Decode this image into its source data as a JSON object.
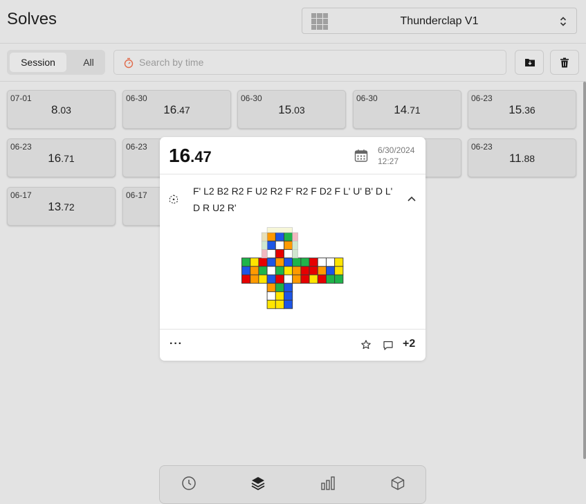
{
  "header": {
    "title": "Solves",
    "cube_name": "Thunderclap V1"
  },
  "toolbar": {
    "tab_session": "Session",
    "tab_all": "All",
    "search_placeholder": "Search by time"
  },
  "solves": [
    {
      "date": "07-01",
      "whole": "8",
      "dec": ".03"
    },
    {
      "date": "06-30",
      "whole": "16",
      "dec": ".47"
    },
    {
      "date": "06-30",
      "whole": "15",
      "dec": ".03"
    },
    {
      "date": "06-30",
      "whole": "14",
      "dec": ".71"
    },
    {
      "date": "06-23",
      "whole": "15",
      "dec": ".36"
    },
    {
      "date": "06-23",
      "whole": "16",
      "dec": ".71"
    },
    {
      "date": "06-23",
      "whole": "",
      "dec": ""
    },
    {
      "date": "",
      "whole": "",
      "dec": ""
    },
    {
      "date": "",
      "whole": "",
      "dec": ""
    },
    {
      "date": "06-23",
      "whole": "11",
      "dec": ".88"
    },
    {
      "date": "06-17",
      "whole": "13",
      "dec": ".72"
    },
    {
      "date": "06-17",
      "whole": "",
      "dec": ""
    }
  ],
  "detail": {
    "whole": "16",
    "dec": ".47",
    "date": "6/30/2024",
    "time": "12:27",
    "scramble": "F' L2 B2 R2 F U2 R2 F' R2 F D2 F L' U' B' D L' D R U2 R'",
    "more_label": "···",
    "penalty_label": "+2"
  },
  "cube_net": {
    "U": [
      [
        "O",
        "B",
        "G"
      ],
      [
        "B",
        "W",
        "O"
      ],
      [
        "W",
        "R",
        "W"
      ]
    ],
    "L": [
      [
        "G",
        "Y",
        "R"
      ],
      [
        "B",
        "O",
        "G"
      ],
      [
        "R",
        "O",
        "Y"
      ]
    ],
    "F": [
      [
        "B",
        "O",
        "B"
      ],
      [
        "W",
        "G",
        "Y"
      ],
      [
        "B",
        "R",
        "W"
      ]
    ],
    "R": [
      [
        "G",
        "G",
        "R"
      ],
      [
        "O",
        "R",
        "R"
      ],
      [
        "O",
        "R",
        "Y"
      ]
    ],
    "B": [
      [
        "W",
        "W",
        "Y"
      ],
      [
        "O",
        "B",
        "Y"
      ],
      [
        "R",
        "G",
        "G"
      ]
    ],
    "D": [
      [
        "O",
        "G",
        "B"
      ],
      [
        "W",
        "Y",
        "B"
      ],
      [
        "Y",
        "Y",
        "B"
      ]
    ]
  },
  "colors": {
    "W": "#ffffff",
    "Y": "#ffe500",
    "R": "#e60000",
    "O": "#ff9a00",
    "G": "#1fb44a",
    "B": "#1e56e6"
  },
  "icons": {
    "cube_select": "grid-icon",
    "nav": [
      "clock-icon",
      "layers-icon",
      "bar-chart-icon",
      "cube-icon"
    ]
  }
}
